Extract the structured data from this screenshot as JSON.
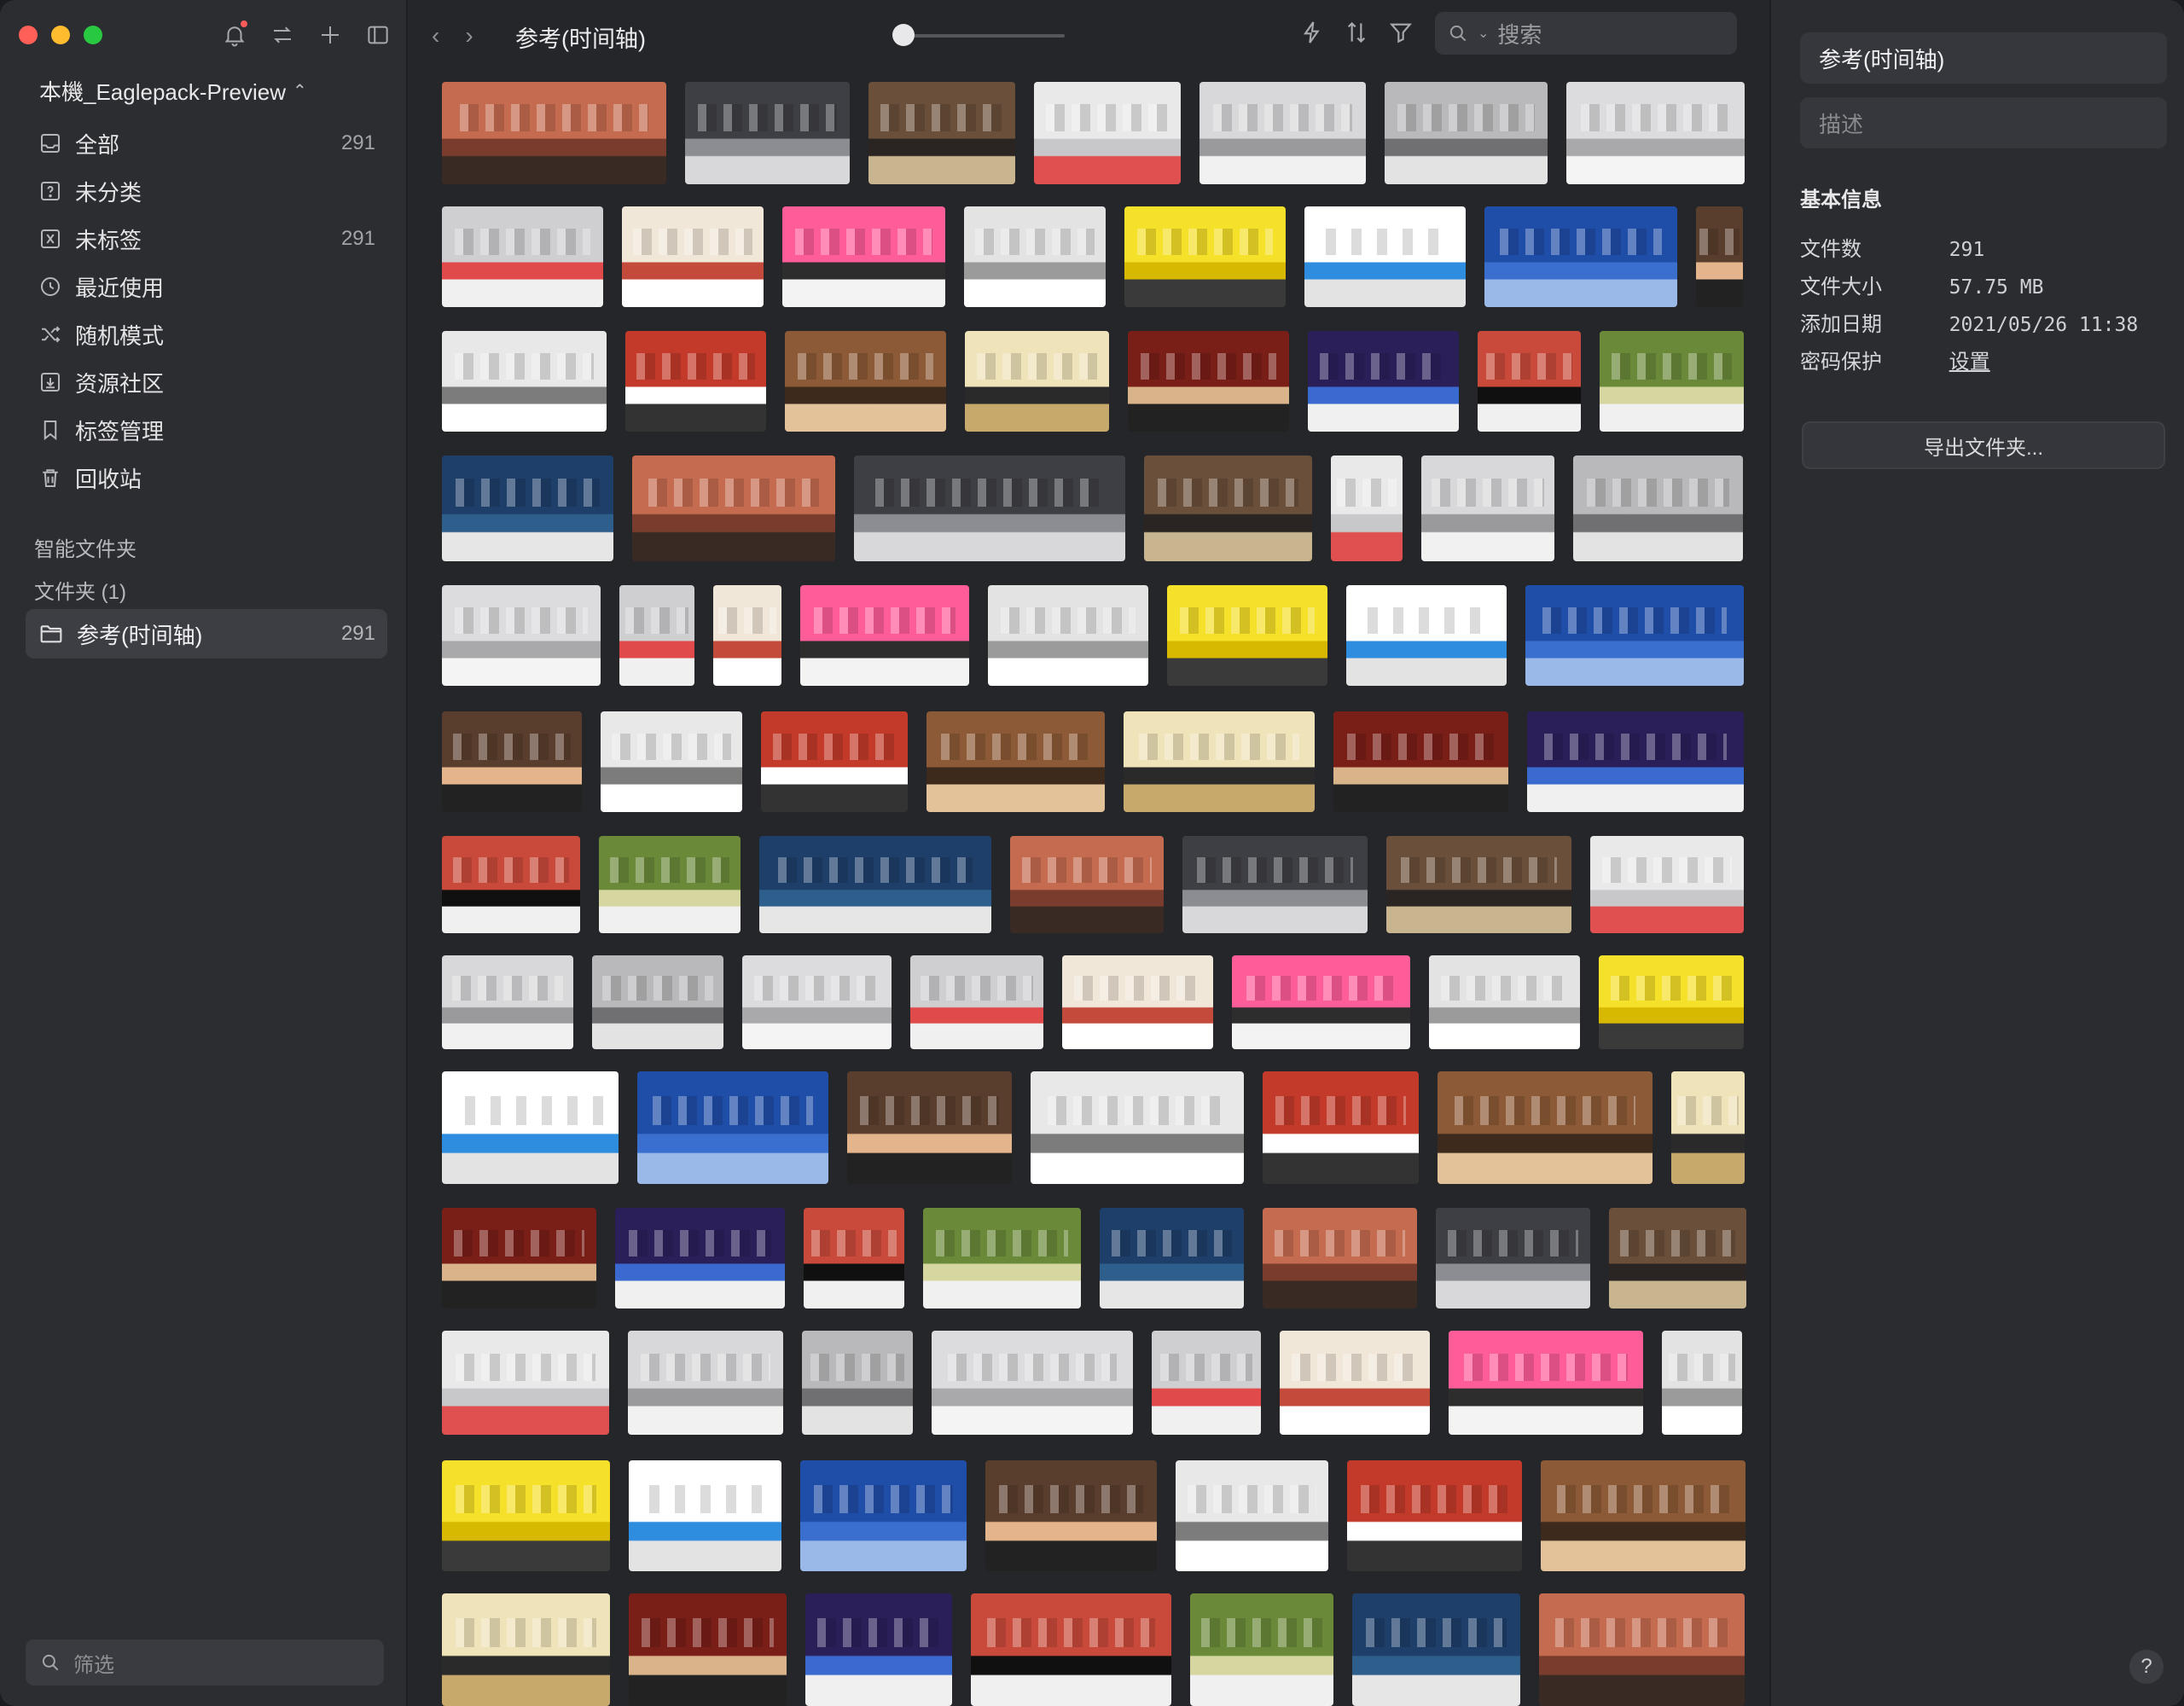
{
  "sidebar": {
    "library_name": "本機_Eaglepack-Preview",
    "items": [
      {
        "label": "全部",
        "count": "291",
        "icon": "inbox-icon"
      },
      {
        "label": "未分类",
        "count": "",
        "icon": "question-box-icon"
      },
      {
        "label": "未标签",
        "count": "291",
        "icon": "untagged-icon"
      },
      {
        "label": "最近使用",
        "count": "",
        "icon": "clock-icon"
      },
      {
        "label": "随机模式",
        "count": "",
        "icon": "shuffle-icon"
      },
      {
        "label": "资源社区",
        "count": "",
        "icon": "download-box-icon"
      },
      {
        "label": "标签管理",
        "count": "",
        "icon": "bookmark-icon"
      },
      {
        "label": "回收站",
        "count": "",
        "icon": "trash-icon"
      }
    ],
    "smart_folders_title": "智能文件夹",
    "folders_title": "文件夹 (1)",
    "active_folder": {
      "label": "参考(时间轴)",
      "count": "291"
    },
    "filter_placeholder": "筛选"
  },
  "toolbar": {
    "title": "参考(时间轴)",
    "search_placeholder": "搜索"
  },
  "inspector": {
    "name_value": "参考(时间轴)",
    "description_placeholder": "描述",
    "info_title": "基本信息",
    "rows": [
      {
        "label": "文件数",
        "value": "291"
      },
      {
        "label": "文件大小",
        "value": "57.75 MB"
      },
      {
        "label": "添加日期",
        "value": "2021/05/26 11:38"
      },
      {
        "label": "密码保护",
        "value": "设置"
      }
    ],
    "export_label": "导出文件夹..."
  },
  "colors": {
    "accent_red": "#fe5f57",
    "accent_yellow": "#febc2e",
    "accent_green": "#28c840"
  }
}
